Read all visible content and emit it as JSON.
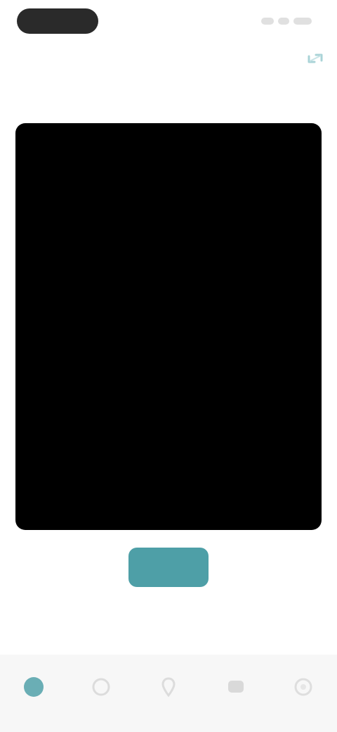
{
  "status_bar": {
    "time": ""
  },
  "header": {
    "title": "",
    "action_icon": "expand-icon"
  },
  "camera": {
    "viewport_state": "black"
  },
  "capture": {
    "button_label": "",
    "hint": ""
  },
  "bottom_nav": {
    "items": [
      {
        "icon": "home-icon",
        "label": "",
        "active": true
      },
      {
        "icon": "clock-icon",
        "label": "",
        "active": false
      },
      {
        "icon": "pin-icon",
        "label": "",
        "active": false
      },
      {
        "icon": "chat-icon",
        "label": "",
        "active": false
      },
      {
        "icon": "settings-icon",
        "label": "",
        "active": false
      }
    ]
  },
  "colors": {
    "accent": "#4e9fa7",
    "viewport": "#000000",
    "background": "#ffffff",
    "nav_background": "#f7f7f7"
  }
}
